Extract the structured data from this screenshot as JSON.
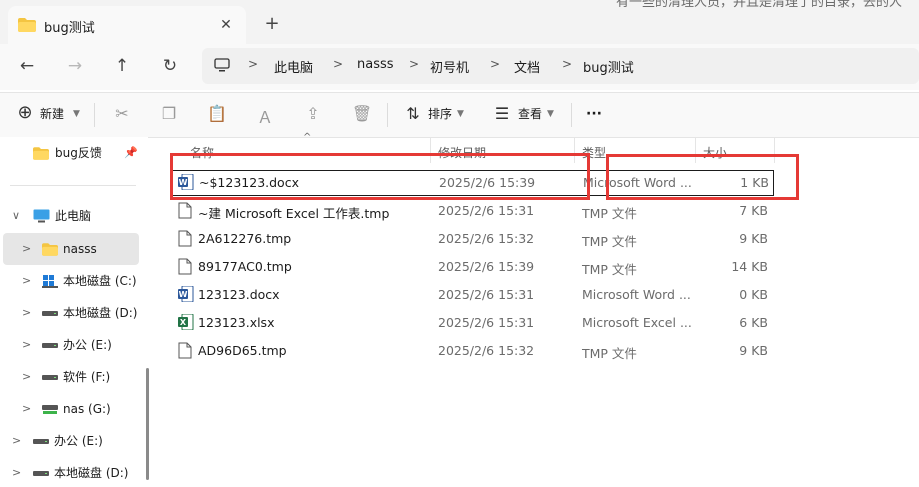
{
  "window": {
    "tab_title": "bug测试",
    "tab_close": "✕",
    "new_tab": "+",
    "background_text": "有一些的清理人员，并且是清理了的目录，去的人"
  },
  "nav": {
    "back": "←",
    "forward": "→",
    "up": "↑",
    "refresh": "↻",
    "breadcrumb": [
      "此电脑",
      "nasss",
      "初号机",
      "文档",
      "bug测试"
    ],
    "separator": ">"
  },
  "toolbar": {
    "new_label": "新建",
    "sort_label": "排序",
    "view_label": "查看",
    "more_label": "···"
  },
  "sidebar": {
    "pinned": [
      {
        "label": "bug反馈"
      }
    ],
    "items": [
      {
        "label": "此电脑",
        "icon": "pc-icon"
      },
      {
        "label": "nasss",
        "icon": "folder-icon"
      },
      {
        "label": "本地磁盘 (C:)",
        "icon": "windows-drive-icon"
      },
      {
        "label": "本地磁盘 (D:)",
        "icon": "drive-icon"
      },
      {
        "label": "办公 (E:)",
        "icon": "drive-icon"
      },
      {
        "label": "软件 (F:)",
        "icon": "drive-icon"
      },
      {
        "label": "nas (G:)",
        "icon": "network-drive-icon"
      },
      {
        "label": "办公 (E:)",
        "icon": "drive-icon"
      },
      {
        "label": "本地磁盘 (D:)",
        "icon": "drive-icon"
      }
    ]
  },
  "columns": {
    "name": "名称",
    "date": "修改日期",
    "type": "类型",
    "size": "大小"
  },
  "files": [
    {
      "name": "~$123123.docx",
      "date": "2025/2/6 15:39",
      "type": "Microsoft Word ...",
      "size": "1 KB",
      "icon": "word-icon"
    },
    {
      "name": "~建 Microsoft Excel 工作表.tmp",
      "date": "2025/2/6 15:31",
      "type": "TMP 文件",
      "size": "7 KB",
      "icon": "file-icon"
    },
    {
      "name": "2A612276.tmp",
      "date": "2025/2/6 15:32",
      "type": "TMP 文件",
      "size": "9 KB",
      "icon": "file-icon"
    },
    {
      "name": "89177AC0.tmp",
      "date": "2025/2/6 15:39",
      "type": "TMP 文件",
      "size": "14 KB",
      "icon": "file-icon"
    },
    {
      "name": "123123.docx",
      "date": "2025/2/6 15:31",
      "type": "Microsoft Word ...",
      "size": "0 KB",
      "icon": "word-icon"
    },
    {
      "name": "123123.xlsx",
      "date": "2025/2/6 15:31",
      "type": "Microsoft Excel ...",
      "size": "6 KB",
      "icon": "excel-icon"
    },
    {
      "name": "AD96D65.tmp",
      "date": "2025/2/6 15:32",
      "type": "TMP 文件",
      "size": "9 KB",
      "icon": "file-icon"
    }
  ],
  "colors": {
    "annotation": "#e53935",
    "folder": "#f4c542",
    "word": "#2b579a",
    "excel": "#217346",
    "selection": "#e6e6e6"
  }
}
